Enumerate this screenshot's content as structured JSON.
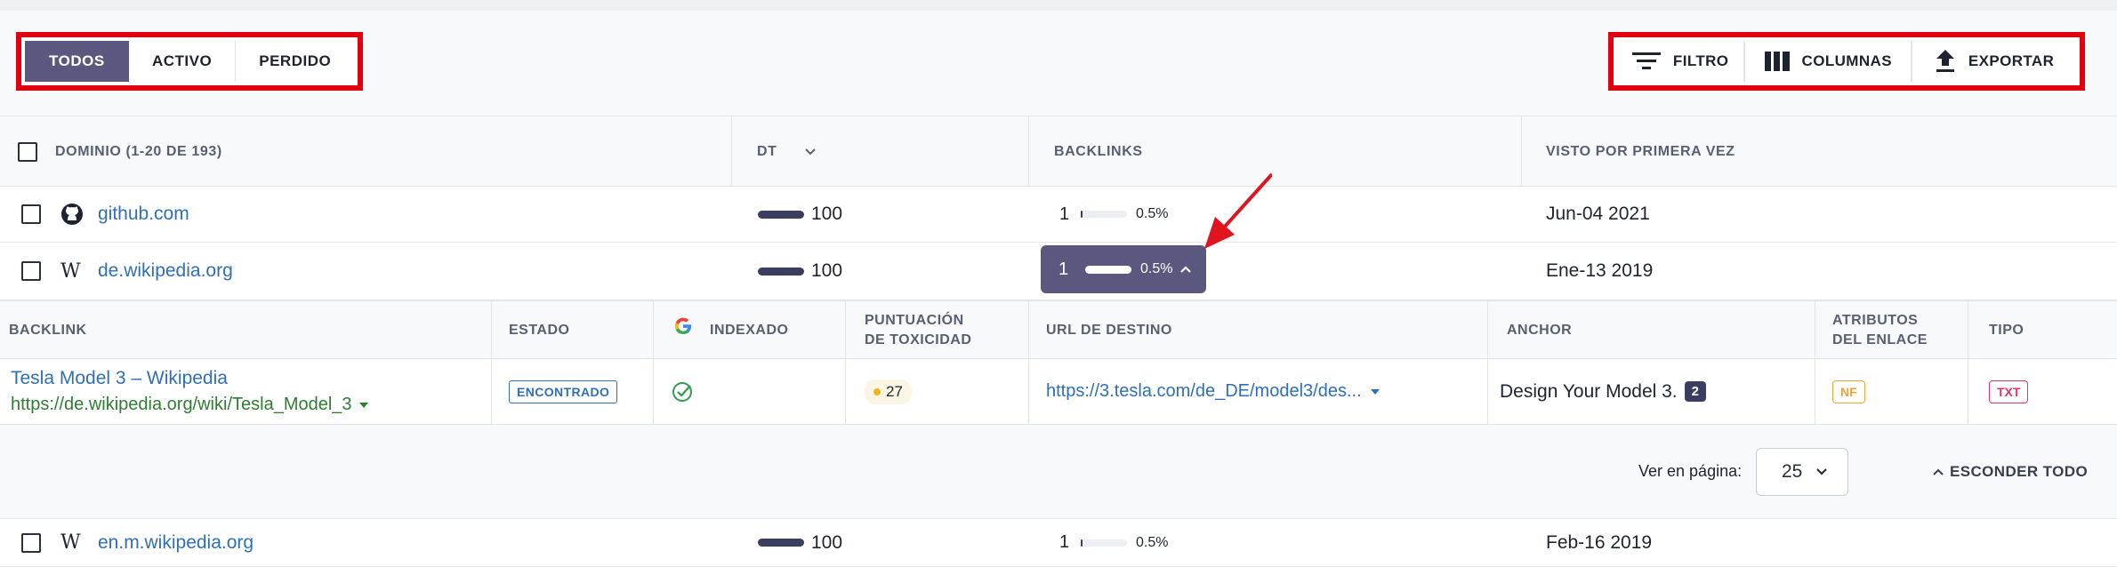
{
  "filters": {
    "segments": [
      {
        "label": "TODOS",
        "active": true
      },
      {
        "label": "ACTIVO",
        "active": false
      },
      {
        "label": "PERDIDO",
        "active": false
      }
    ]
  },
  "actions": {
    "filter_label": "FILTRO",
    "columns_label": "COLUMNAS",
    "export_label": "EXPORTAR"
  },
  "table": {
    "headers": {
      "domain": "DOMINIO (1-20 DE 193)",
      "dt": "DT",
      "backlinks": "BACKLINKS",
      "first_seen": "VISTO POR PRIMERA VEZ"
    },
    "rows": [
      {
        "domain": "github.com",
        "icon": "github-icon",
        "dt": "100",
        "backlinks": "1",
        "pct": "0.5%",
        "first_seen": "Jun-04 2021"
      },
      {
        "domain": "de.wikipedia.org",
        "icon": "wikipedia-icon",
        "dt": "100",
        "backlinks": "1",
        "pct": "0.5%",
        "first_seen": "Ene-13 2019"
      },
      {
        "domain": "en.m.wikipedia.org",
        "icon": "wikipedia-icon",
        "dt": "100",
        "backlinks": "1",
        "pct": "0.5%",
        "first_seen": "Feb-16 2019"
      }
    ]
  },
  "expanded": {
    "headers": {
      "backlink": "BACKLINK",
      "estado": "ESTADO",
      "indexado": "INDEXADO",
      "toxicity_1": "PUNTUACIÓN",
      "toxicity_2": "DE TOXICIDAD",
      "target": "URL DE DESTINO",
      "anchor": "ANCHOR",
      "attrs_1": "ATRIBUTOS",
      "attrs_2": "DEL ENLACE",
      "tipo": "TIPO"
    },
    "row": {
      "title": "Tesla Model 3 – Wikipedia",
      "url": "https://de.wikipedia.org/wiki/Tesla_Model_3",
      "estado": "ENCONTRADO",
      "toxicity": "27",
      "target_url": "https://3.tesla.com/de_DE/model3/des...",
      "anchor": "Design Your Model 3.",
      "anchor_count": "2",
      "attribute": "NF",
      "tipo": "TXT"
    },
    "pagination": {
      "label": "Ver en página:",
      "value": "25",
      "hide_all": "ESCONDER TODO"
    }
  },
  "colors": {
    "accent": "#5b5880",
    "highlight_box": "#e00010",
    "link": "#2f6fb6",
    "url_green": "#2e7d32"
  }
}
